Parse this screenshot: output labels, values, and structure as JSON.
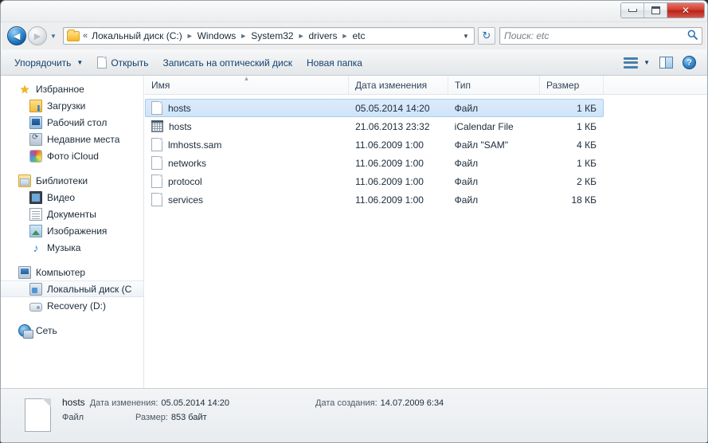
{
  "window": {
    "controls": {
      "minimize": "minimize-button",
      "maximize": "maximize-button",
      "close_label": "✕"
    }
  },
  "nav": {
    "back_glyph": "◄",
    "forward_glyph": "►",
    "dropdown_glyph": "▼",
    "refresh_glyph": "↻",
    "overflow_chevrons": "«",
    "breadcrumbs": [
      {
        "label": "Локальный диск (C:)"
      },
      {
        "label": "Windows"
      },
      {
        "label": "System32"
      },
      {
        "label": "drivers"
      },
      {
        "label": "etc"
      }
    ],
    "separator": "►"
  },
  "search": {
    "placeholder": "Поиск: etc",
    "value": "",
    "icon_glyph": "🔍"
  },
  "toolbar": {
    "organize_label": "Упорядочить",
    "open_label": "Открыть",
    "burn_label": "Записать на оптический диск",
    "new_folder_label": "Новая папка",
    "caret": "▼",
    "help_glyph": "?"
  },
  "sidebar": {
    "groups": [
      {
        "header": {
          "label": "Избранное",
          "icon": "star-icon"
        },
        "items": [
          {
            "label": "Загрузки",
            "icon": "downloads-icon"
          },
          {
            "label": "Рабочий стол",
            "icon": "desktop-icon"
          },
          {
            "label": "Недавние места",
            "icon": "recent-places-icon"
          },
          {
            "label": "Фото iCloud",
            "icon": "icloud-photos-icon"
          }
        ]
      },
      {
        "header": {
          "label": "Библиотеки",
          "icon": "libraries-icon"
        },
        "items": [
          {
            "label": "Видео",
            "icon": "video-icon"
          },
          {
            "label": "Документы",
            "icon": "documents-icon"
          },
          {
            "label": "Изображения",
            "icon": "pictures-icon"
          },
          {
            "label": "Музыка",
            "icon": "music-icon"
          }
        ]
      },
      {
        "header": {
          "label": "Компьютер",
          "icon": "computer-icon"
        },
        "items": [
          {
            "label": "Локальный диск (C",
            "icon": "local-disk-icon",
            "selected": true
          },
          {
            "label": "Recovery (D:)",
            "icon": "recovery-drive-icon"
          }
        ]
      },
      {
        "header": {
          "label": "Сеть",
          "icon": "network-icon"
        },
        "items": []
      }
    ]
  },
  "filelist": {
    "columns": [
      {
        "key": "name",
        "label": "Имя",
        "sorted": true,
        "sort_glyph": "▲"
      },
      {
        "key": "date",
        "label": "Дата изменения"
      },
      {
        "key": "type",
        "label": "Тип"
      },
      {
        "key": "size",
        "label": "Размер"
      }
    ],
    "rows": [
      {
        "name": "hosts",
        "date": "05.05.2014 14:20",
        "type": "Файл",
        "size": "1 КБ",
        "icon": "file-blank-icon",
        "selected": true
      },
      {
        "name": "hosts",
        "date": "21.06.2013 23:32",
        "type": "iCalendar File",
        "size": "1 КБ",
        "icon": "calendar-file-icon",
        "selected": false
      },
      {
        "name": "lmhosts.sam",
        "date": "11.06.2009 1:00",
        "type": "Файл \"SAM\"",
        "size": "4 КБ",
        "icon": "file-blank-icon",
        "selected": false
      },
      {
        "name": "networks",
        "date": "11.06.2009 1:00",
        "type": "Файл",
        "size": "1 КБ",
        "icon": "file-blank-icon",
        "selected": false
      },
      {
        "name": "protocol",
        "date": "11.06.2009 1:00",
        "type": "Файл",
        "size": "2 КБ",
        "icon": "file-blank-icon",
        "selected": false
      },
      {
        "name": "services",
        "date": "11.06.2009 1:00",
        "type": "Файл",
        "size": "18 КБ",
        "icon": "file-blank-icon",
        "selected": false
      }
    ]
  },
  "statusbar": {
    "file_name": "hosts",
    "modified_label": "Дата изменения:",
    "modified_value": "05.05.2014 14:20",
    "created_label": "Дата создания:",
    "created_value": "14.07.2009 6:34",
    "type_value": "Файл",
    "size_label": "Размер:",
    "size_value": "853 байт"
  },
  "colors": {
    "selection_fill": "#cfe4f9",
    "selection_border": "#a8cdf0",
    "link_text": "#13436e",
    "close_button": "#cf3a2c"
  }
}
